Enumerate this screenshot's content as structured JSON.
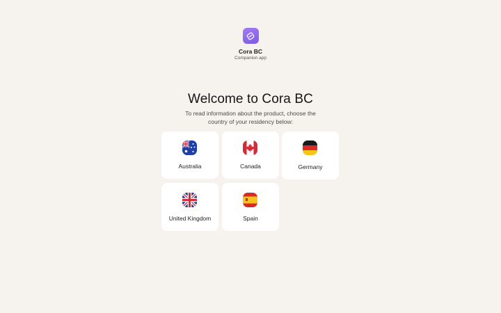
{
  "app": {
    "name": "Cora BC",
    "subtitle": "Companion app",
    "icon": "card-swap-icon",
    "accent": "#8b68ec"
  },
  "welcome": {
    "title": "Welcome to Cora BC",
    "text": "To read information about the product, choose the country of your residency below:"
  },
  "countries": [
    {
      "name": "Australia",
      "flag": "australia-flag-icon"
    },
    {
      "name": "Canada",
      "flag": "canada-flag-icon"
    },
    {
      "name": "Germany",
      "flag": "germany-flag-icon"
    },
    {
      "name": "United Kingdom",
      "flag": "united-kingdom-flag-icon"
    },
    {
      "name": "Spain",
      "flag": "spain-flag-icon"
    }
  ]
}
